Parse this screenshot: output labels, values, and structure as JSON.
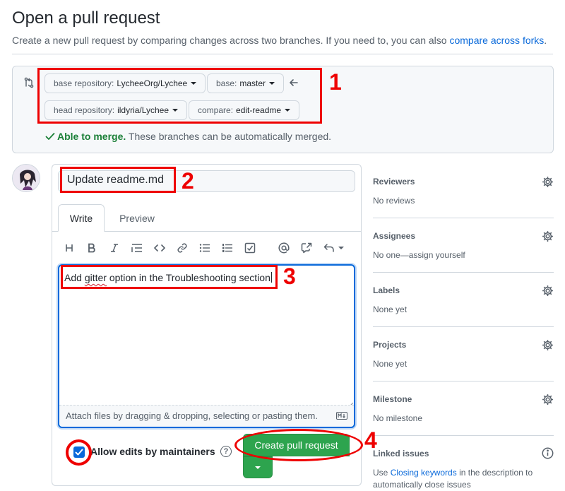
{
  "header": {
    "title": "Open a pull request",
    "subtitle_prefix": "Create a new pull request by comparing changes across two branches. If you need to, you can also ",
    "subtitle_link": "compare across forks",
    "subtitle_suffix": "."
  },
  "compare": {
    "base_repo_label": "base repository:",
    "base_repo_value": "LycheeOrg/Lychee",
    "base_label": "base:",
    "base_value": "master",
    "head_repo_label": "head repository:",
    "head_repo_value": "ildyria/Lychee",
    "compare_label": "compare:",
    "compare_value": "edit-readme",
    "merge_ok": "Able to merge.",
    "merge_text": "These branches can be automatically merged."
  },
  "composer": {
    "title_value": "Update readme.md",
    "tab_write": "Write",
    "tab_preview": "Preview",
    "body_word1": "Add ",
    "body_misspelled": "gitter",
    "body_rest": " option in the Troubleshooting section",
    "attach_hint": "Attach files by dragging & dropping, selecting or pasting them.",
    "allow_edits_label": "Allow edits by maintainers",
    "allow_edits_checked": true,
    "create_button": "Create pull request",
    "help_glyph": "?"
  },
  "sidebar": {
    "reviewers": {
      "title": "Reviewers",
      "value": "No reviews"
    },
    "assignees": {
      "title": "Assignees",
      "value": "No one—assign yourself"
    },
    "labels": {
      "title": "Labels",
      "value": "None yet"
    },
    "projects": {
      "title": "Projects",
      "value": "None yet"
    },
    "milestone": {
      "title": "Milestone",
      "value": "No milestone"
    },
    "linked_issues": {
      "title": "Linked issues",
      "prefix": "Use ",
      "link": "Closing keywords",
      "suffix": " in the description to",
      "line2": "automatically close issues"
    }
  },
  "annotations": {
    "n1": "1",
    "n2": "2",
    "n3": "3",
    "n4": "4"
  },
  "colors": {
    "accent_blue": "#0969da",
    "success_green": "#2da44e",
    "merge_green": "#1a7f37",
    "annotation_red": "#ee0000"
  },
  "icons": [
    "git-compare-icon",
    "arrow-left-icon",
    "check-icon",
    "heading-icon",
    "bold-icon",
    "italic-icon",
    "quote-icon",
    "code-icon",
    "link-icon",
    "bulleted-list-icon",
    "numbered-list-icon",
    "tasklist-icon",
    "mention-icon",
    "cross-reference-icon",
    "reply-icon",
    "markdown-icon",
    "question-icon",
    "gear-icon",
    "info-icon"
  ]
}
